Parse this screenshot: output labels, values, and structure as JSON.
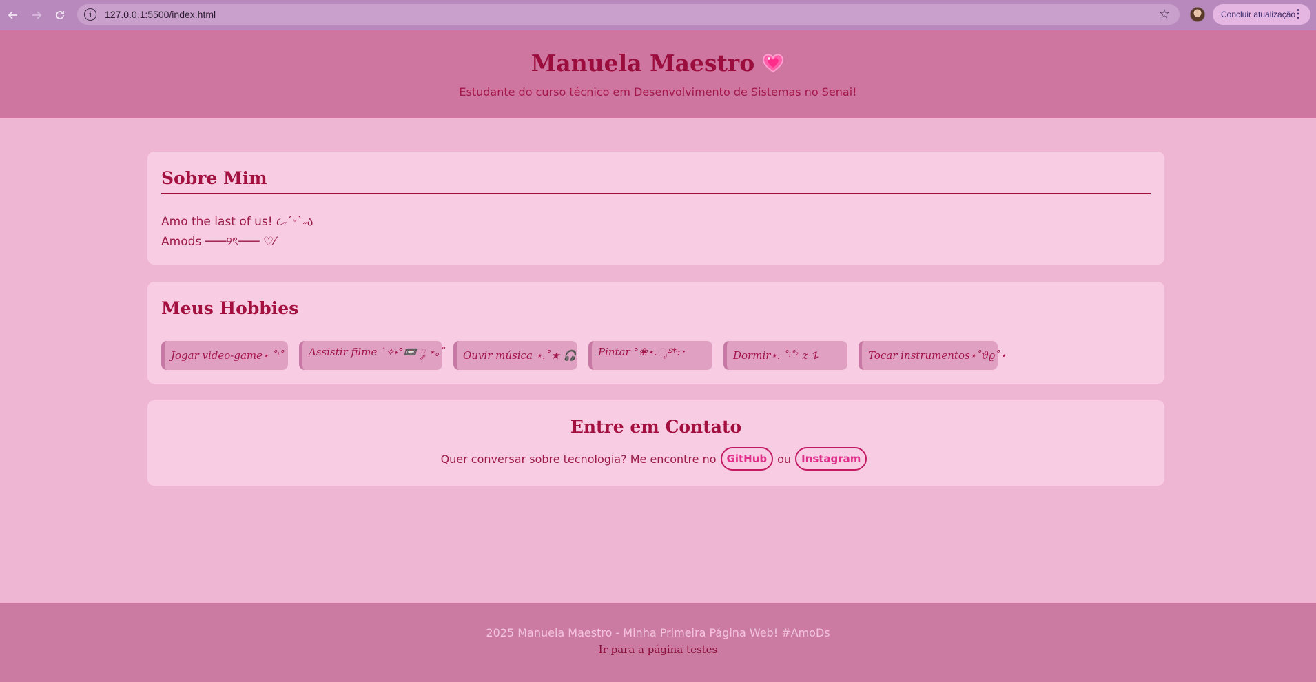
{
  "browser": {
    "url": "127.0.0.1:5500/index.html",
    "update_button_label": "Concluir atualização",
    "icons": [
      "back-arrow-icon",
      "forward-arrow-icon",
      "reload-icon",
      "site-info-icon",
      "bookmark-star-icon",
      "menu-dots-icon"
    ]
  },
  "header": {
    "title": "Manuela Maestro",
    "subtitle": "Estudante do curso técnico em Desenvolvimento de Sistemas no Senai!"
  },
  "about": {
    "title": "Sobre Mim",
    "lines": [
      "Amo the last of us! ૮˶ˊᵕˋ˶ა",
      "Amods ───୨ৎ─── ♡⁄"
    ]
  },
  "hobbies": {
    "title": "Meus Hobbies",
    "items": [
      "Jogar video-game⋆ ˚ᵎ˚",
      "Assistir filme ˙✧˖°📼 ༘ ⋆｡˚",
      "Ouvir música ⋆.˚★ 🎧",
      "Pintar °❀⋆.ೃ࿔*:･",
      "Dormir⋆. ˚ᵎ˚ᶻ z 𐰁",
      "Tocar instrumentos⋆˚𝜗𝜚˚⋆"
    ]
  },
  "contact": {
    "title": "Entre em Contato",
    "text_before": "Quer conversar sobre tecnologia? Me encontre no",
    "github_label": "GitHub",
    "text_between": "ou",
    "instagram_label": "Instagram"
  },
  "footer": {
    "text": "2025 Manuela Maestro - Minha Primeira Página Web! #AmoDs",
    "link_label": "Ir para a página testes"
  },
  "colors": {
    "header_bg": "#cf76a0",
    "page_bg": "#efb6d4",
    "card_bg": "#f8cde3",
    "title_color": "#9b0d3d",
    "link_color": "#e0308a",
    "footer_bg": "#cb7ba2"
  }
}
